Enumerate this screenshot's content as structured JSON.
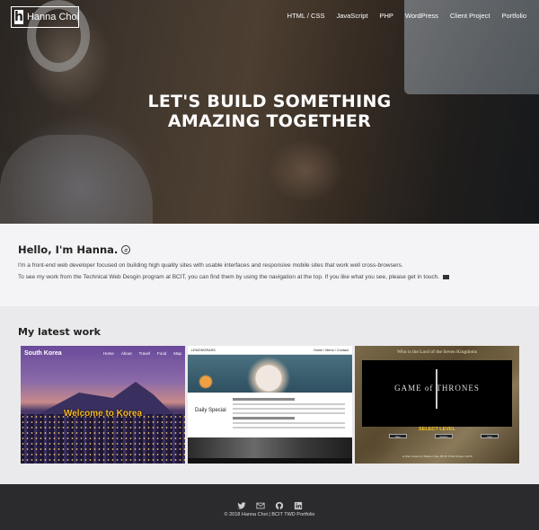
{
  "header": {
    "logo_letter": "h",
    "logo_text": "Hanna Choi",
    "nav": [
      "HTML / CSS",
      "JavaScript",
      "PHP",
      "WordPress",
      "Client Project",
      "Portfolio"
    ],
    "hero_line1": "LET'S BUILD SOMETHING",
    "hero_line2": "AMAZING TOGETHER"
  },
  "intro": {
    "heading": "Hello, I'm Hanna.",
    "para1": "I'm a front-end web developer focused on building high quality sites with usable interfaces and responsive mobile sites that work well cross-browsers.",
    "para2": "To see my work from the Technical Web Desgin program at BCIT, you can find them by using the navigation at the top. If you like what you see, please get in touch."
  },
  "work": {
    "heading": "My latest work",
    "korea": {
      "brand": "South Korea",
      "links": [
        "Home",
        "About",
        "Travel",
        "Food",
        "Map"
      ],
      "welcome": "Welcome to Korea"
    },
    "food": {
      "bar_left": "LEMONGRASS",
      "bar_right": "Home / Menu / Contact",
      "special": "Daily Special"
    },
    "got": {
      "top": "Who is the Lord of the Seven Kingdoms",
      "title": "GAME of THRONES",
      "select": "SELECT LEVEL",
      "buttons": [
        "Easy",
        "Medium",
        "Hard"
      ],
      "bottom": "A Web Game by Hanna Choi, BCIT TWD Project 2018"
    }
  },
  "footer": {
    "icons": [
      "twitter-icon",
      "mail-icon",
      "github-icon",
      "linkedin-icon"
    ],
    "copyright": "© 2018 Hanna Choi | BCIT TWD Portfolio"
  }
}
